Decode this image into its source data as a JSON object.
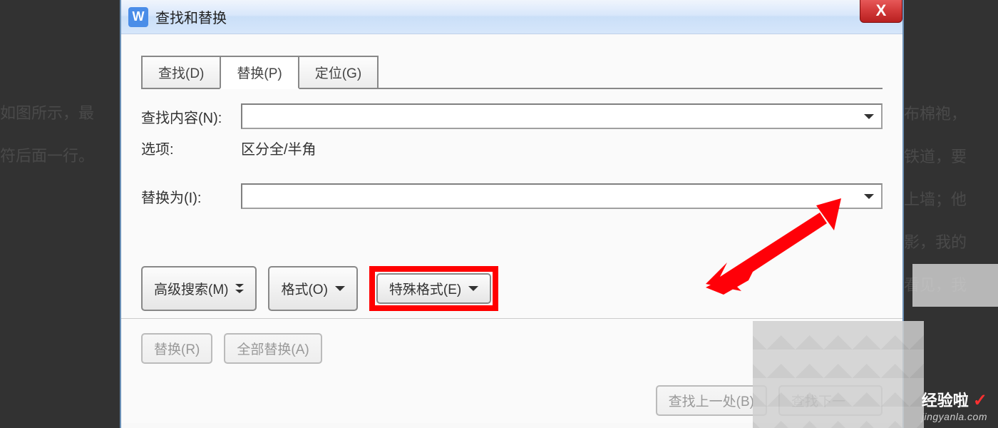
{
  "dialog": {
    "title": "查找和替换",
    "app_icon_letter": "W",
    "close_label": "X"
  },
  "tabs": {
    "find": "查找(D)",
    "replace": "替换(P)",
    "goto": "定位(G)"
  },
  "labels": {
    "find_what": "查找内容(N):",
    "options": "选项:",
    "replace_with": "替换为(I):"
  },
  "options_value": "区分全/半角",
  "buttons": {
    "advanced": "高级搜索(M)",
    "format": "格式(O)",
    "special": "特殊格式(E)",
    "replace": "替换(R)",
    "replace_all": "全部替换(A)",
    "find_prev": "查找上一处(B)",
    "find_next": "查找下一"
  },
  "background": {
    "line1": "如图所示，最",
    "line2": "符后面一行。",
    "r1": "布棉袍，",
    "r2": "铁道，要",
    "r3": "上墙；他",
    "r4": "影，我的",
    "r5": "看见，我"
  },
  "watermark": {
    "main": "经验啦",
    "sub": "jingyanla.com"
  }
}
